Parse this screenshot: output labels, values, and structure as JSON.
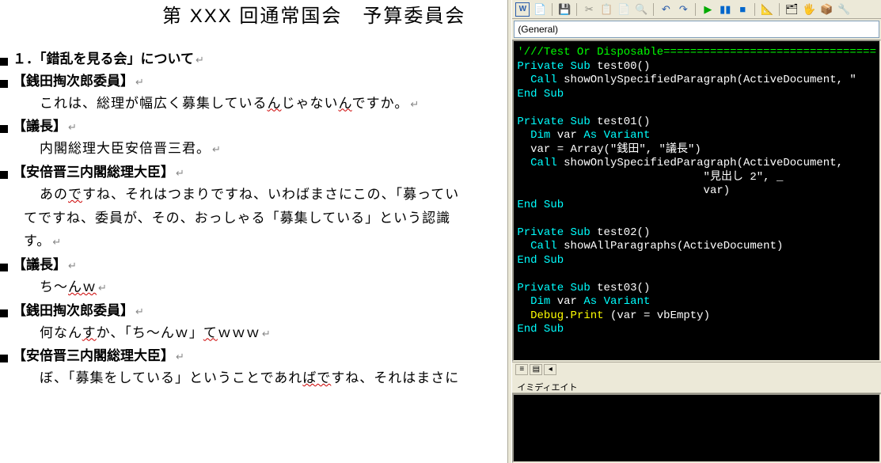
{
  "doc": {
    "title": "第 XXX 回通常国会　予算委員会",
    "section_heading": "１．「錯乱を見る会」について",
    "speakers": {
      "s1": "【銭田掏次郎委員】",
      "s2": "【議長】",
      "s3": "【安倍晋三内閣総理大臣】",
      "s4": "【議長】",
      "s5": "【銭田掏次郎委員】",
      "s6": "【安倍晋三内閣総理大臣】"
    },
    "lines": {
      "l1": "これは、総理が幅広く募集している",
      "l1b": "ん",
      "l1c": "じゃない",
      "l1d": "ん",
      "l1e": "ですか。",
      "l2": "内閣総理大臣安倍晋三君。",
      "l3a": "あの",
      "l3b": "で",
      "l3c": "すね、それはつまりですね、いわばまさにこの、「募ってい",
      "l4": "てですね、委員が、その、おっしゃる「募集している」という認識",
      "l5": "す。",
      "l6a": "ち～",
      "l6b": "んｗ",
      "l7a": "何なん",
      "l7b": "す",
      "l7c": "か、「ち～んｗ」",
      "l7d": "て",
      "l7e": "ｗｗｗ",
      "l8a": "ぼ、「募集をしている」ということであれ",
      "l8b": "ばで",
      "l8c": "すね、それはまさに"
    },
    "ret": "↵"
  },
  "vbe": {
    "dropdown_general": "(General)",
    "code": {
      "comment1": "'///Test Or Disposable================================",
      "priv": "Private Sub",
      "endsub": "End Sub",
      "call": "Call",
      "dim": "Dim",
      "as": "As",
      "variant": "Variant",
      "debug": "Debug",
      "print": "Print",
      "t00": " test00()",
      "t00b": " showOnlySpecifiedParagraph(ActiveDocument, \"",
      "t01": " test01()",
      "t01a": " var ",
      "t01b": "  var = Array(\"銭田\", \"議長\")",
      "t01c": " showOnlySpecifiedParagraph(ActiveDocument, ",
      "t01d": "                            \"見出し 2\", _",
      "t01e": "                            var)",
      "t02": " test02()",
      "t02b": " showAllParagraphs(ActiveDocument)",
      "t03": " test03()",
      "t03a": " var ",
      "t03b": " (var = vbEmpty)"
    },
    "immediate_title": "イミディエイト"
  }
}
